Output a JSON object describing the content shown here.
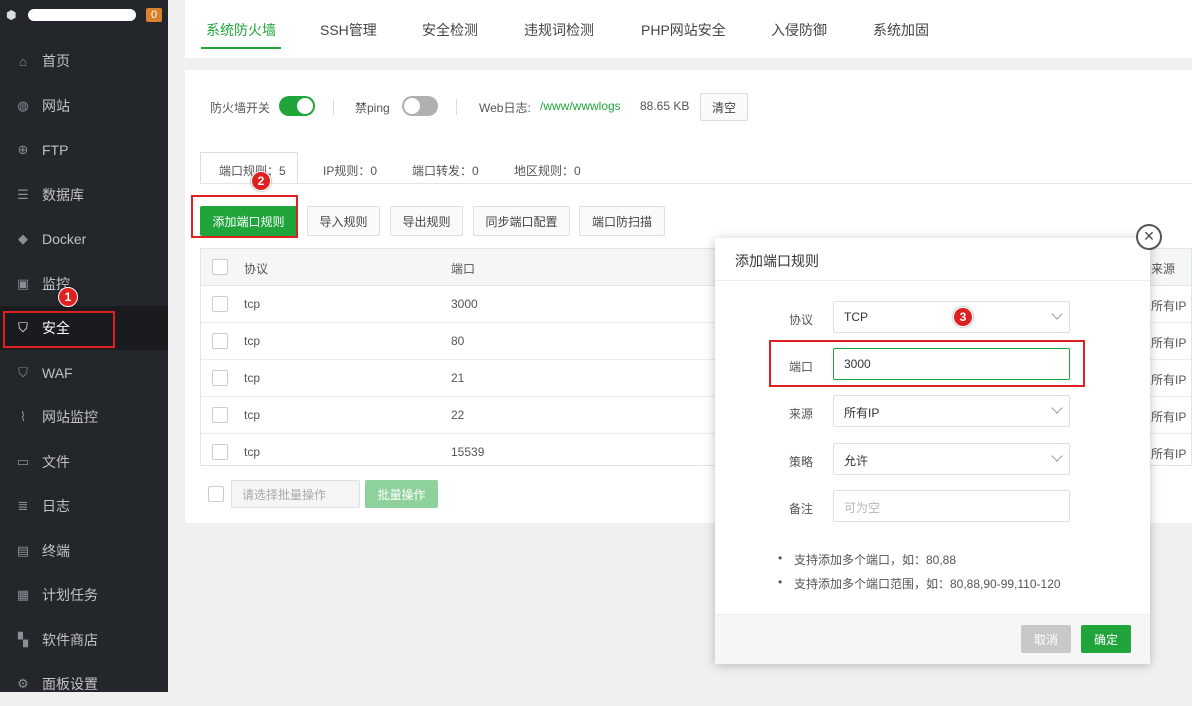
{
  "sidebar": {
    "badge": "0",
    "items": [
      {
        "label": "首页",
        "icon": "home-icon"
      },
      {
        "label": "网站",
        "icon": "globe-icon"
      },
      {
        "label": "FTP",
        "icon": "ftp-icon"
      },
      {
        "label": "数据库",
        "icon": "database-icon"
      },
      {
        "label": "Docker",
        "icon": "docker-icon"
      },
      {
        "label": "监控",
        "icon": "monitor-icon"
      },
      {
        "label": "安全",
        "icon": "shield-icon"
      },
      {
        "label": "WAF",
        "icon": "waf-icon"
      },
      {
        "label": "网站监控",
        "icon": "chart-icon"
      },
      {
        "label": "文件",
        "icon": "folder-icon"
      },
      {
        "label": "日志",
        "icon": "log-icon"
      },
      {
        "label": "终端",
        "icon": "terminal-icon"
      },
      {
        "label": "计划任务",
        "icon": "calendar-icon"
      },
      {
        "label": "软件商店",
        "icon": "apps-icon"
      },
      {
        "label": "面板设置",
        "icon": "gear-icon"
      }
    ]
  },
  "tabs": [
    "系统防火墙",
    "SSH管理",
    "安全检测",
    "违规词检测",
    "PHP网站安全",
    "入侵防御",
    "系统加固"
  ],
  "status": {
    "firewall_label": "防火墙开关",
    "ping_label": "禁ping",
    "weblog_label": "Web日志:",
    "weblog_path": "/www/wwwlogs",
    "weblog_size": "88.65 KB",
    "clear_button": "清空"
  },
  "subtabs": [
    "端口规则：5",
    "IP规则：0",
    "端口转发：0",
    "地区规则：0"
  ],
  "actions": [
    "添加端口规则",
    "导入规则",
    "导出规则",
    "同步端口配置",
    "端口防扫描"
  ],
  "table": {
    "headers": {
      "protocol": "协议",
      "port": "端口",
      "source": "来源"
    },
    "rows": [
      {
        "protocol": "tcp",
        "port": "3000",
        "source": "所有IP"
      },
      {
        "protocol": "tcp",
        "port": "80",
        "source": "所有IP"
      },
      {
        "protocol": "tcp",
        "port": "21",
        "source": "所有IP"
      },
      {
        "protocol": "tcp",
        "port": "22",
        "source": "所有IP"
      },
      {
        "protocol": "tcp",
        "port": "15539",
        "source": "所有IP"
      }
    ]
  },
  "batch": {
    "select_placeholder": "请选择批量操作",
    "button": "批量操作"
  },
  "markers": [
    "1",
    "2",
    "3"
  ],
  "modal": {
    "title": "添加端口规则",
    "protocol_label": "协议",
    "protocol_value": "TCP",
    "port_label": "端口",
    "port_value": "3000",
    "source_label": "来源",
    "source_value": "所有IP",
    "strategy_label": "策略",
    "strategy_value": "允许",
    "note_label": "备注",
    "note_placeholder": "可为空",
    "hint1": "支持添加多个端口，如：80,88",
    "hint2": "支持添加多个端口范围，如：80,88,90-99,110-120",
    "cancel": "取消",
    "confirm": "确定",
    "close": "×"
  }
}
